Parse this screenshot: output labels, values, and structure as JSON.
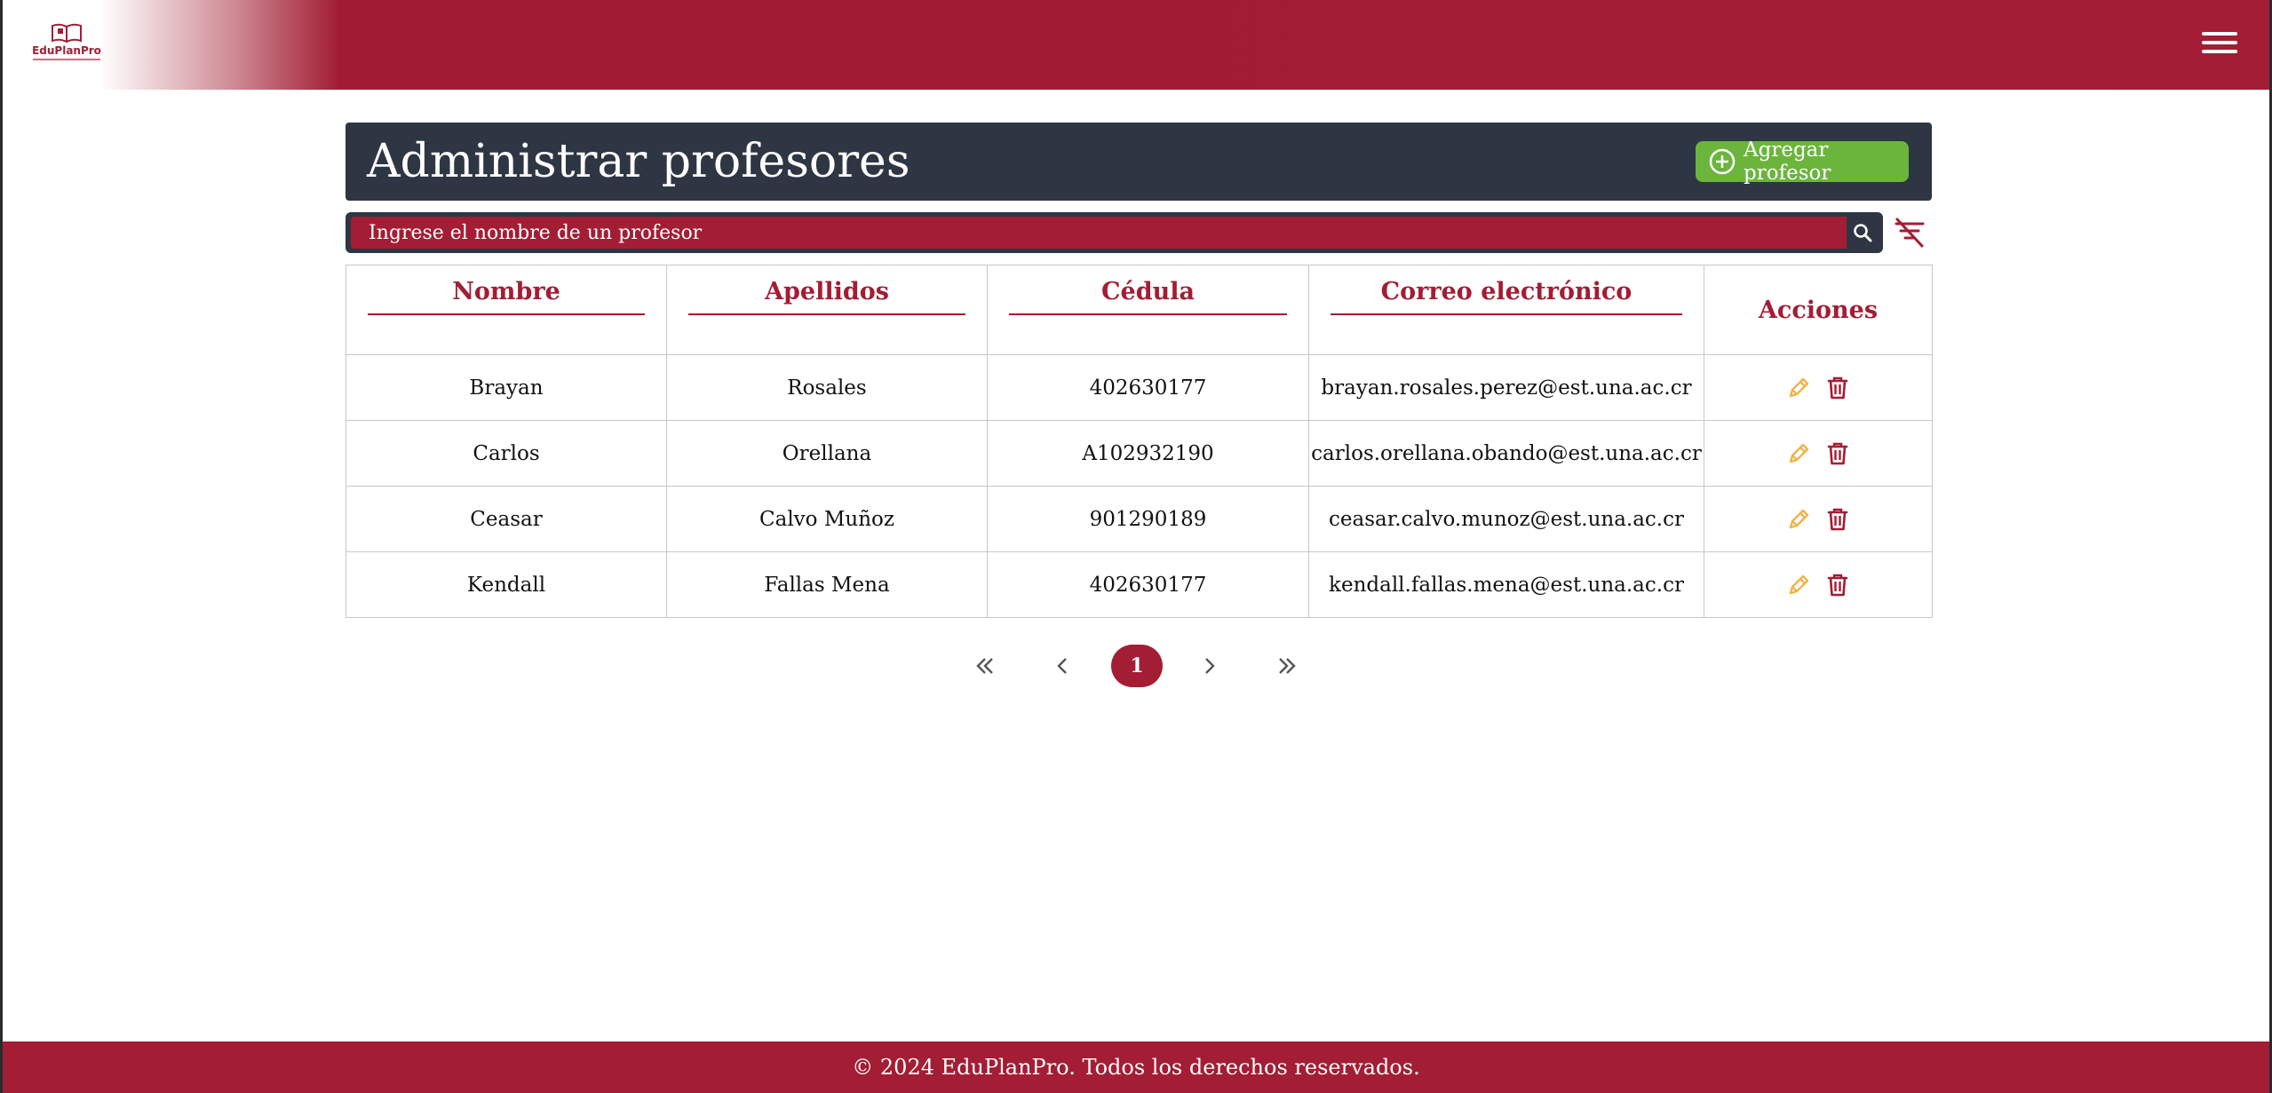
{
  "header": {
    "logo_text": "EduPlanPro",
    "menu_icon": "hamburger-menu-icon"
  },
  "page": {
    "title": "Administrar profesores",
    "add_button": "Agregar profesor",
    "add_icon": "plus-circle-icon"
  },
  "search": {
    "placeholder": "Ingrese el nombre de un profesor",
    "value": "",
    "search_icon": "search-icon",
    "clear_filter_icon": "filter-off-icon"
  },
  "table": {
    "headers": [
      "Nombre",
      "Apellidos",
      "Cédula",
      "Correo electrónico",
      "Acciones"
    ],
    "rows": [
      {
        "nombre": "Brayan",
        "apellidos": "Rosales",
        "cedula": "402630177",
        "correo": "brayan.rosales.perez@est.una.ac.cr"
      },
      {
        "nombre": "Carlos",
        "apellidos": "Orellana",
        "cedula": "A102932190",
        "correo": "carlos.orellana.obando@est.una.ac.cr"
      },
      {
        "nombre": "Ceasar",
        "apellidos": "Calvo Muñoz",
        "cedula": "901290189",
        "correo": "ceasar.calvo.munoz@est.una.ac.cr"
      },
      {
        "nombre": "Kendall",
        "apellidos": "Fallas Mena",
        "cedula": "402630177",
        "correo": "kendall.fallas.mena@est.una.ac.cr"
      }
    ],
    "edit_icon": "pencil-icon",
    "delete_icon": "trash-icon"
  },
  "pagination": {
    "current_page": "1"
  },
  "footer": {
    "text": "© 2024 EduPlanPro. Todos los derechos reservados."
  },
  "colors": {
    "brand": "#a31d34",
    "dark": "#2e3643",
    "success": "#6bb53d",
    "edit": "#f0b449"
  }
}
